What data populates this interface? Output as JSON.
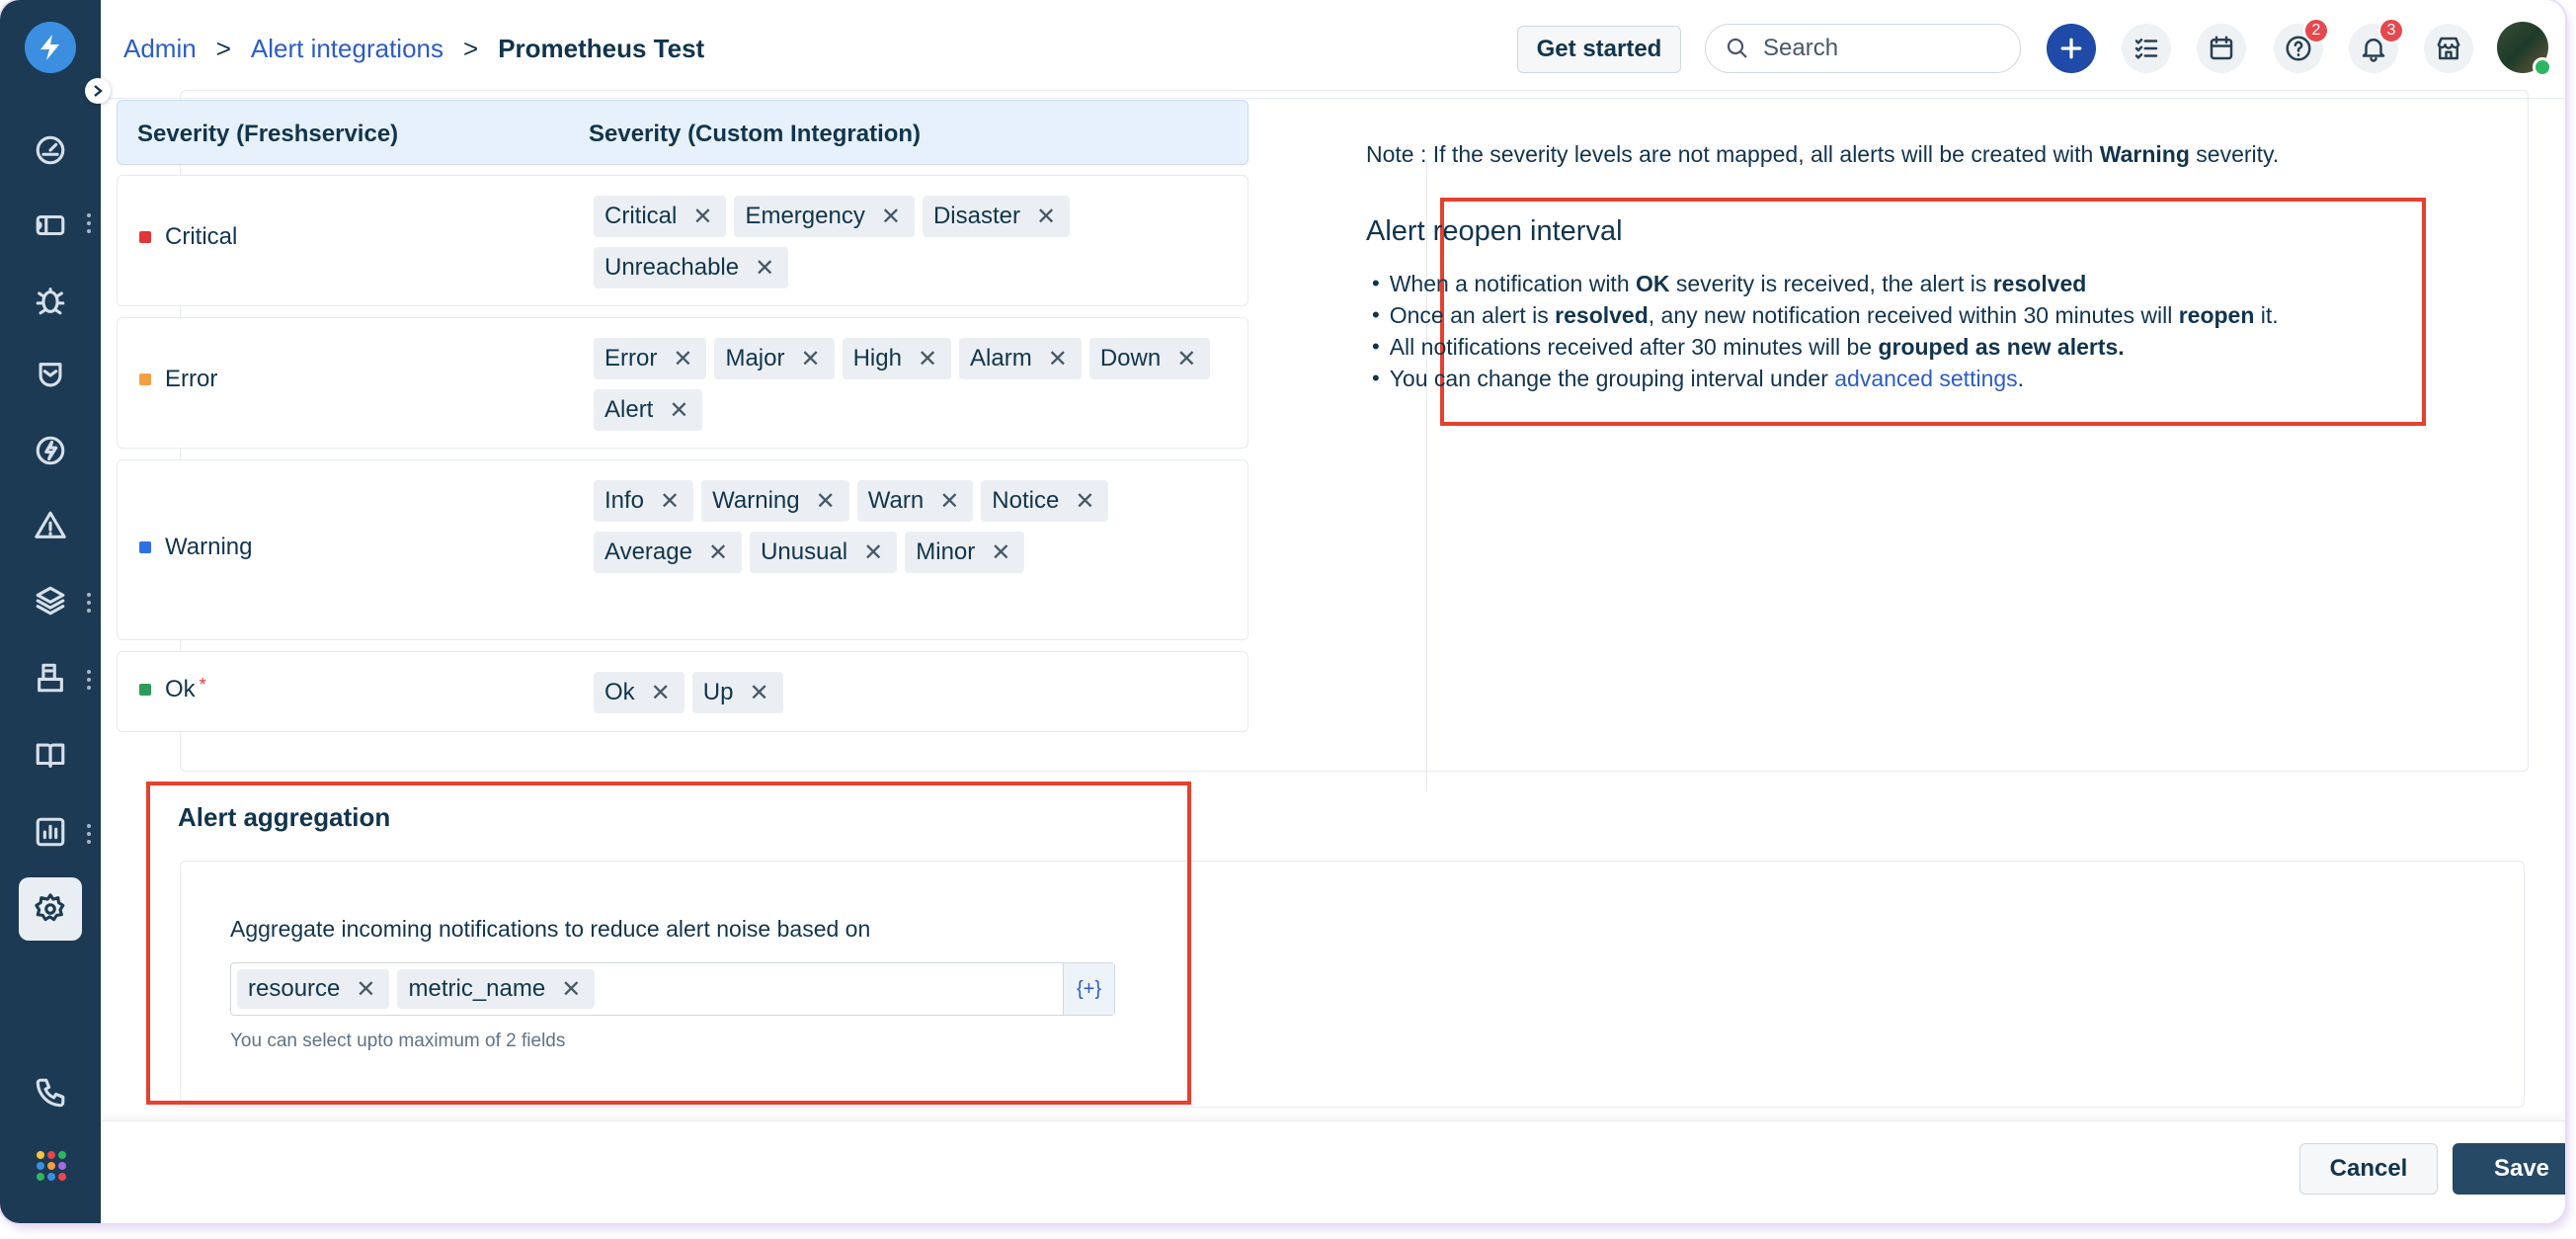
{
  "colors": {
    "sidebar": "#1d3a54",
    "accent": "#2c5cc5",
    "primary_button": "#264966",
    "highlight_box": "#e5412e",
    "critical": "#e43538",
    "error": "#f59e42",
    "warning": "#2f6fe4",
    "ok": "#2e9a5c"
  },
  "breadcrumb": {
    "admin": "Admin",
    "alert_integrations": "Alert integrations",
    "current": "Prometheus Test",
    "separator": ">"
  },
  "header": {
    "get_started": "Get started",
    "search_placeholder": "Search",
    "help_badge": "2",
    "notifications_badge": "3"
  },
  "sidebar": {
    "icons": [
      "dashboard-icon",
      "tickets-icon",
      "problems-icon",
      "changes-icon",
      "releases-icon",
      "alerts-icon",
      "assets-icon",
      "projects-icon",
      "solutions-icon",
      "reports-icon",
      "admin-settings-icon",
      "phone-icon",
      "apps-icon"
    ]
  },
  "severity_table": {
    "col1": "Severity (Freshservice)",
    "col2": "Severity (Custom Integration)",
    "rows": [
      {
        "label": "Critical",
        "tags": [
          "Critical",
          "Emergency",
          "Disaster",
          "Unreachable"
        ]
      },
      {
        "label": "Error",
        "tags": [
          "Error",
          "Major",
          "High",
          "Alarm",
          "Down",
          "Alert"
        ]
      },
      {
        "label": "Warning",
        "tags": [
          "Info",
          "Warning",
          "Warn",
          "Notice",
          "Average",
          "Unusual",
          "Minor"
        ]
      },
      {
        "label": "Ok",
        "tags": [
          "Ok",
          "Up"
        ],
        "required": "*"
      }
    ]
  },
  "note": {
    "prefix": "Note : If the severity levels are not mapped, all alerts will be created with ",
    "bold": "Warning",
    "suffix": " severity."
  },
  "reopen": {
    "title": "Alert reopen interval",
    "b1": {
      "t1": "When a notification with ",
      "b1": "OK",
      "t2": " severity is received, the alert is ",
      "b2": "resolved"
    },
    "b2": {
      "t1": "Once an alert is ",
      "b1": "resolved",
      "t2": ", any new notification received within 30 minutes will ",
      "b2": "reopen",
      "t3": " it."
    },
    "b3": {
      "t1": "All notifications received after 30 minutes will be ",
      "b1": "grouped as new alerts."
    },
    "b4": {
      "t1": "You can change the grouping interval under ",
      "link": "advanced settings",
      "t2": "."
    }
  },
  "aggregation": {
    "title": "Alert aggregation",
    "label": "Aggregate incoming notifications to reduce alert noise based on",
    "fields": [
      "resource",
      "metric_name"
    ],
    "placeholder_button": "{+}",
    "hint": "You can select upto maximum of 2 fields"
  },
  "footer": {
    "cancel": "Cancel",
    "save": "Save"
  },
  "remove_glyph": "✕"
}
